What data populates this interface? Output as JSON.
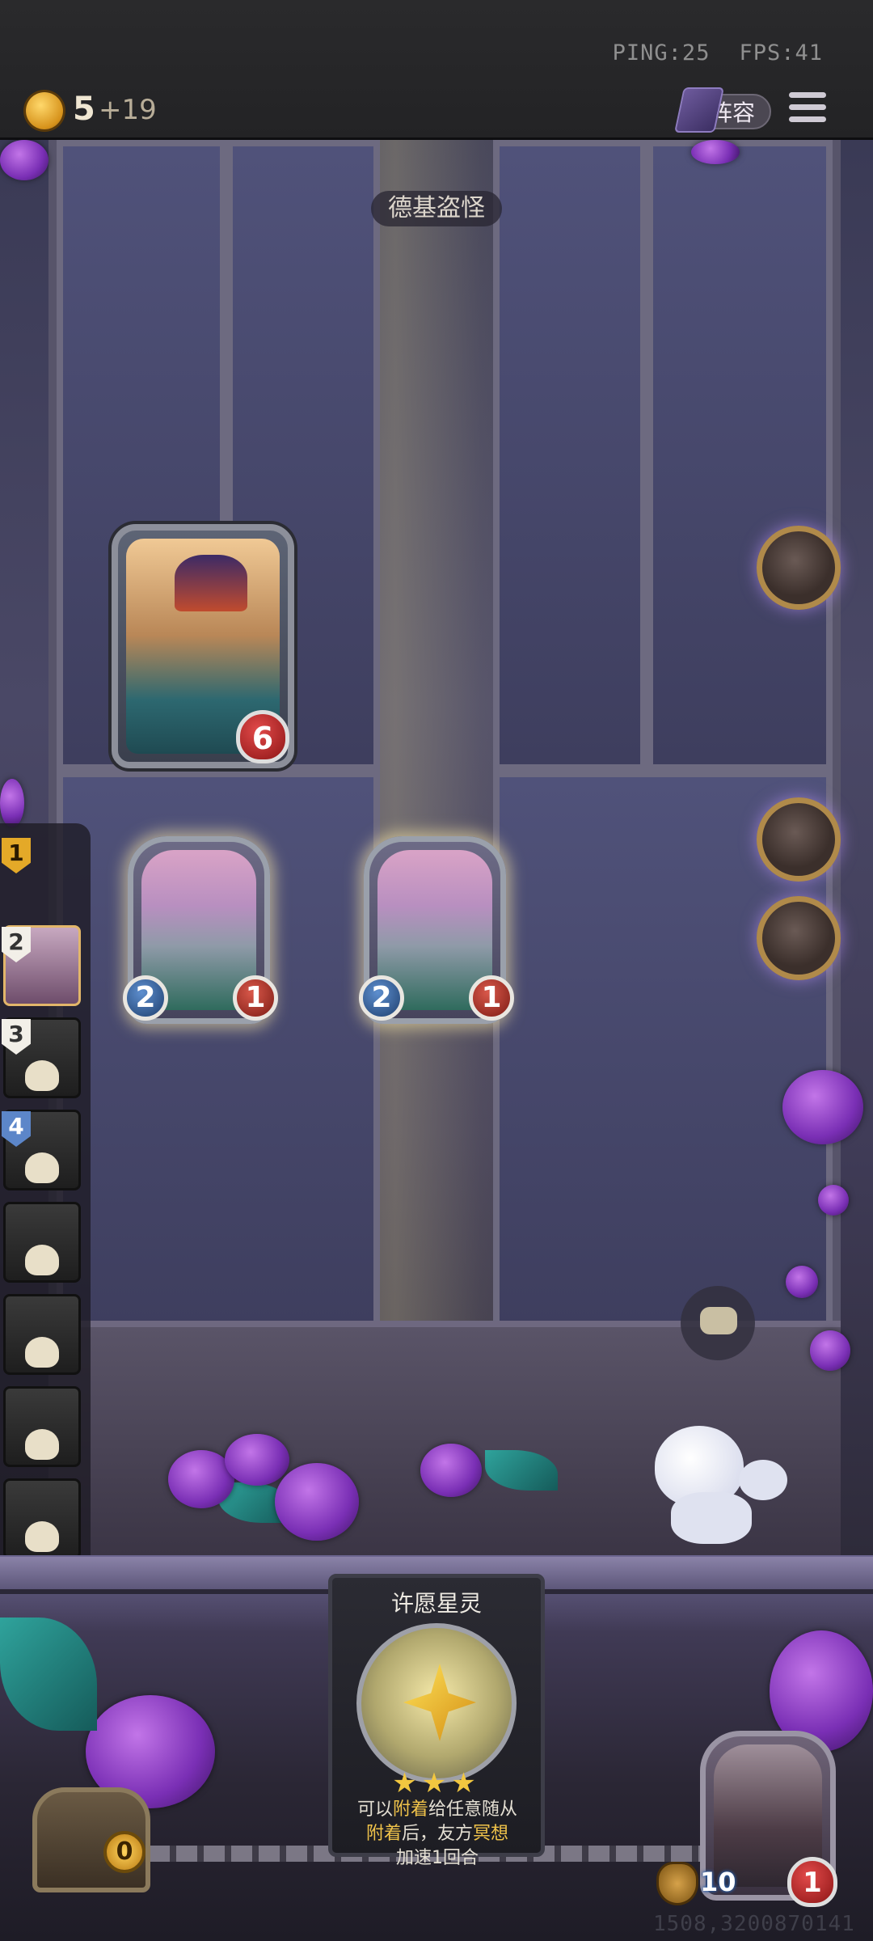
{
  "status": {
    "ping": "PING:25",
    "fps": "FPS:41"
  },
  "economy": {
    "gold": "5",
    "gold_income": "+19"
  },
  "header": {
    "lineup_label": "阵容"
  },
  "enemy": {
    "name": "德基盗怪",
    "health": "6"
  },
  "board_minions": [
    {
      "attack": "2",
      "health": "1"
    },
    {
      "attack": "2",
      "health": "1"
    }
  ],
  "leaderboard": [
    {
      "rank": "1",
      "rank_color": "gold",
      "status": "current-empty"
    },
    {
      "rank": "2",
      "rank_color": "white",
      "status": "alive"
    },
    {
      "rank": "3",
      "rank_color": "white",
      "status": "eliminated"
    },
    {
      "rank": "4",
      "rank_color": "blue",
      "status": "eliminated"
    },
    {
      "rank": "",
      "status": "eliminated"
    },
    {
      "rank": "",
      "status": "eliminated"
    },
    {
      "rank": "",
      "status": "eliminated"
    },
    {
      "rank": "",
      "status": "eliminated"
    }
  ],
  "hand_card": {
    "title": "许愿星灵",
    "stars": "★★★",
    "desc_parts": [
      "可以",
      "附着",
      "给任意随从",
      "附着",
      "后，友方",
      "冥想",
      "加速1回合"
    ]
  },
  "treasure": {
    "value": "0"
  },
  "player": {
    "armor_attack": "10",
    "health": "1"
  },
  "coordinates": "1508,3200870141",
  "colors": {
    "gold": "#e4a928",
    "health_red": "#d9584a",
    "attack_blue": "#5e8fcf",
    "highlight": "#f0c34a"
  }
}
